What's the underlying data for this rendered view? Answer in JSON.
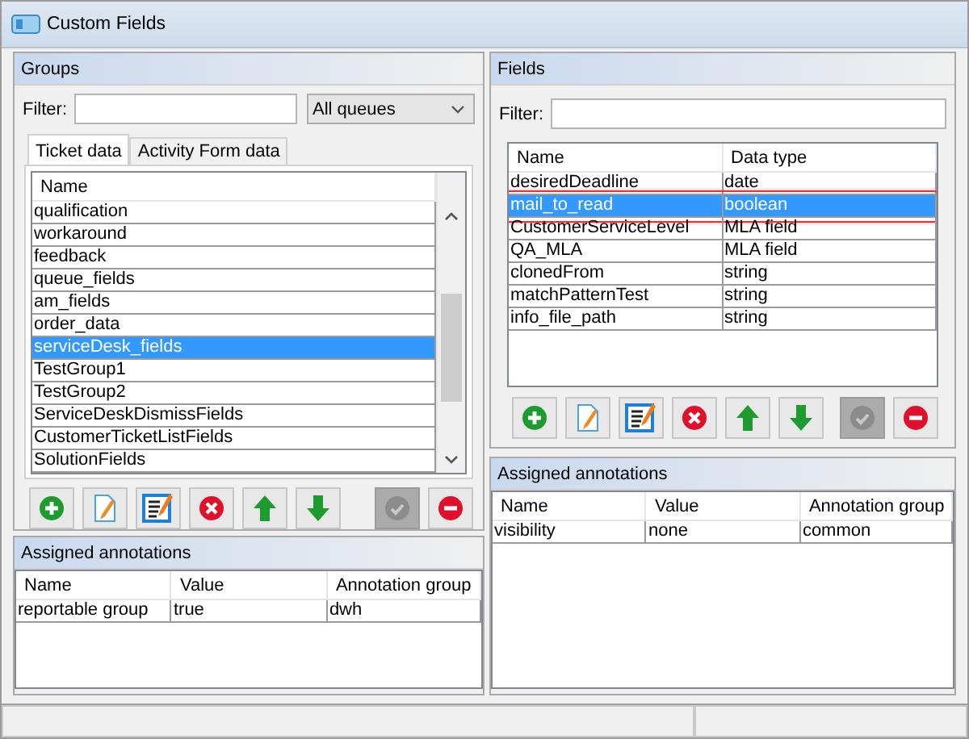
{
  "window": {
    "title": "Custom Fields"
  },
  "groups": {
    "title": "Groups",
    "filter": {
      "label": "Filter:"
    },
    "queue_select": {
      "value": "All queues"
    },
    "tabs": [
      {
        "label": "Ticket data",
        "selected": true
      },
      {
        "label": "Activity Form data",
        "selected": false
      }
    ],
    "table": {
      "columns": [
        "Name"
      ],
      "rows": [
        {
          "cells": [
            "qualification"
          ],
          "selected": false
        },
        {
          "cells": [
            "workaround"
          ],
          "selected": false
        },
        {
          "cells": [
            "feedback"
          ],
          "selected": false
        },
        {
          "cells": [
            "queue_fields"
          ],
          "selected": false
        },
        {
          "cells": [
            "am_fields"
          ],
          "selected": false
        },
        {
          "cells": [
            "order_data"
          ],
          "selected": false
        },
        {
          "cells": [
            "serviceDesk_fields"
          ],
          "selected": true
        },
        {
          "cells": [
            "TestGroup1"
          ],
          "selected": false
        },
        {
          "cells": [
            "TestGroup2"
          ],
          "selected": false
        },
        {
          "cells": [
            "ServiceDeskDismissFields"
          ],
          "selected": false
        },
        {
          "cells": [
            "CustomerTicketListFields"
          ],
          "selected": false
        },
        {
          "cells": [
            "SolutionFields"
          ],
          "selected": false
        }
      ]
    },
    "toolbar": [
      {
        "kind": "add",
        "disabled": false
      },
      {
        "kind": "edit",
        "disabled": false
      },
      {
        "kind": "edit_list",
        "disabled": false
      },
      {
        "kind": "delete",
        "disabled": false
      },
      {
        "kind": "up",
        "disabled": false
      },
      {
        "kind": "down",
        "disabled": false
      },
      {
        "kind": "apply",
        "disabled": true
      },
      {
        "kind": "remove",
        "disabled": false
      }
    ]
  },
  "groups_annotations": {
    "title": "Assigned annotations",
    "table": {
      "columns": [
        "Name",
        "Value",
        "Annotation group"
      ],
      "rows": [
        {
          "cells": [
            "reportable group",
            "true",
            "dwh"
          ]
        }
      ]
    }
  },
  "fields": {
    "title": "Fields",
    "filter": {
      "label": "Filter:"
    },
    "table": {
      "columns": [
        "Name",
        "Data type"
      ],
      "rows": [
        {
          "cells": [
            "desiredDeadline",
            "date"
          ],
          "selected": false,
          "highlighted": false
        },
        {
          "cells": [
            "mail_to_read",
            "boolean"
          ],
          "selected": true,
          "highlighted": true
        },
        {
          "cells": [
            "CustomerServiceLevel",
            "MLA field"
          ],
          "selected": false,
          "highlighted": false
        },
        {
          "cells": [
            "QA_MLA",
            "MLA field"
          ],
          "selected": false,
          "highlighted": false
        },
        {
          "cells": [
            "clonedFrom",
            "string"
          ],
          "selected": false,
          "highlighted": false
        },
        {
          "cells": [
            "matchPatternTest",
            "string"
          ],
          "selected": false,
          "highlighted": false
        },
        {
          "cells": [
            "info_file_path",
            "string"
          ],
          "selected": false,
          "highlighted": false
        }
      ]
    },
    "toolbar": [
      {
        "kind": "add",
        "disabled": false
      },
      {
        "kind": "edit",
        "disabled": false
      },
      {
        "kind": "edit_list",
        "disabled": false
      },
      {
        "kind": "delete",
        "disabled": false
      },
      {
        "kind": "up",
        "disabled": false
      },
      {
        "kind": "down",
        "disabled": false
      },
      {
        "kind": "apply",
        "disabled": true
      },
      {
        "kind": "remove",
        "disabled": false
      }
    ]
  },
  "fields_annotations": {
    "title": "Assigned annotations",
    "table": {
      "columns": [
        "Name",
        "Value",
        "Annotation group"
      ],
      "rows": [
        {
          "cells": [
            "visibility",
            "none",
            "common"
          ]
        }
      ]
    }
  }
}
